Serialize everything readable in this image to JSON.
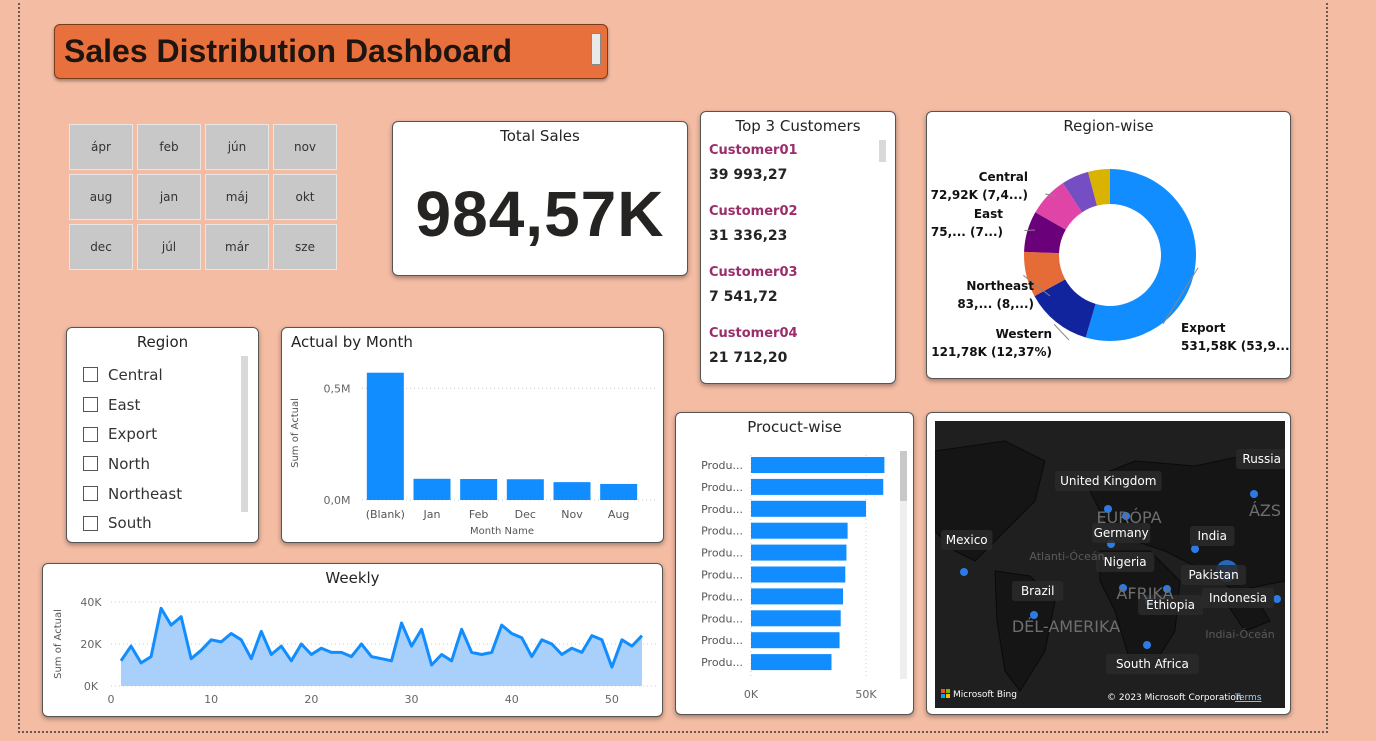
{
  "dashboard": {
    "title": "Sales Distribution Dashboard"
  },
  "months": [
    "ápr",
    "feb",
    "jún",
    "nov",
    "aug",
    "jan",
    "máj",
    "okt",
    "dec",
    "júl",
    "már",
    "sze"
  ],
  "total_sales": {
    "title": "Total Sales",
    "value": "984,57K"
  },
  "top_customers": {
    "title": "Top 3 Customers",
    "items": [
      {
        "name": "Customer01",
        "value": "39 993,27"
      },
      {
        "name": "Customer02",
        "value": "31 336,23"
      },
      {
        "name": "Customer03",
        "value": "7 541,72"
      },
      {
        "name": "Customer04",
        "value": "21 712,20"
      }
    ]
  },
  "region_slicer": {
    "title": "Region",
    "items": [
      "Central",
      "East",
      "Export",
      "North",
      "Northeast",
      "South"
    ]
  },
  "colors": {
    "accent": "#118dff",
    "title_bg": "#e8703c",
    "background": "#f3bca3",
    "customer_name": "#9a2d6a"
  },
  "chart_data": [
    {
      "type": "pie",
      "title": "Region-wise",
      "slices": [
        {
          "name": "Export",
          "value": 531.58,
          "label": "531,58K (53,9...)",
          "color": "#118dff"
        },
        {
          "name": "Western",
          "value": 121.78,
          "label": "121,78K (12,37%)",
          "color": "#12239e"
        },
        {
          "name": "Northeast",
          "value": 83,
          "label": "83,... (8,...)",
          "color": "#e66c37"
        },
        {
          "name": "East",
          "value": 75,
          "label": "75,... (7...)",
          "color": "#6b007b"
        },
        {
          "name": "Central",
          "value": 72.92,
          "label": "72,92K (7,4...)",
          "color": "#e044a7"
        },
        {
          "name": "",
          "value": 50,
          "label": "",
          "color": "#744ec2"
        },
        {
          "name": "",
          "value": 40,
          "label": "",
          "color": "#d9b300"
        }
      ]
    },
    {
      "type": "bar",
      "title": "Actual by Month",
      "xlabel": "Month Name",
      "ylabel": "Sum of Actual",
      "categories": [
        "(Blank)",
        "Jan",
        "Feb",
        "Dec",
        "Nov",
        "Aug"
      ],
      "values": [
        0.57,
        0.095,
        0.094,
        0.093,
        0.08,
        0.072
      ],
      "ylim": [
        0,
        0.6
      ],
      "yticks": [
        {
          "v": 0.5,
          "label": "0,5M"
        },
        {
          "v": 0,
          "label": "0,0M"
        }
      ]
    },
    {
      "type": "bar",
      "title": "Procuct-wise",
      "orientation": "horizontal",
      "categories": [
        "Produ...",
        "Produ...",
        "Produ...",
        "Produ...",
        "Produ...",
        "Produ...",
        "Produ...",
        "Produ...",
        "Produ...",
        "Produ..."
      ],
      "values": [
        58,
        57.5,
        50,
        42,
        41.5,
        41,
        40,
        39,
        38.5,
        35
      ],
      "xlim": [
        0,
        60
      ],
      "xticks": [
        {
          "v": 0,
          "label": "0K"
        },
        {
          "v": 50,
          "label": "50K"
        }
      ]
    },
    {
      "type": "area",
      "title": "Weekly",
      "ylabel": "Sum of Actual",
      "x": [
        1,
        2,
        3,
        4,
        5,
        6,
        7,
        8,
        9,
        10,
        11,
        12,
        13,
        14,
        15,
        16,
        17,
        18,
        19,
        20,
        21,
        22,
        23,
        24,
        25,
        26,
        27,
        28,
        29,
        30,
        31,
        32,
        33,
        34,
        35,
        36,
        37,
        38,
        39,
        40,
        41,
        42,
        43,
        44,
        45,
        46,
        47,
        48,
        49,
        50,
        51,
        52,
        53
      ],
      "y": [
        12,
        19,
        11,
        14,
        37,
        29,
        33,
        13,
        17,
        22,
        21,
        25,
        22,
        13,
        26,
        15,
        19,
        12,
        20,
        15,
        18,
        16,
        16,
        14,
        20,
        14,
        13,
        12,
        30,
        19,
        27,
        10,
        15,
        12,
        27,
        16,
        15,
        16,
        29,
        25,
        23,
        14,
        22,
        20,
        15,
        18,
        16,
        24,
        22,
        9,
        22,
        19,
        24
      ],
      "ylim": [
        0,
        40
      ],
      "xticks": [
        0,
        10,
        20,
        30,
        40,
        50
      ],
      "yticks": [
        {
          "v": 40,
          "label": "40K"
        },
        {
          "v": 20,
          "label": "20K"
        },
        {
          "v": 0,
          "label": "0K"
        }
      ]
    }
  ],
  "map": {
    "labels": [
      "Russia",
      "United Kingdom",
      "EURÓPA",
      "ÁZS",
      "Germany",
      "India",
      "Mexico",
      "Atlanti-Óceán",
      "Nigeria",
      "AFRIKA",
      "Pakistan",
      "Brazil",
      "Ethiopia",
      "Indonesia",
      "DÉL-AMERIKA",
      "Indiai-Óceán",
      "South Africa"
    ],
    "brand": "Microsoft Bing",
    "copyright": "© 2023 Microsoft Corporation",
    "terms": "Terms"
  }
}
